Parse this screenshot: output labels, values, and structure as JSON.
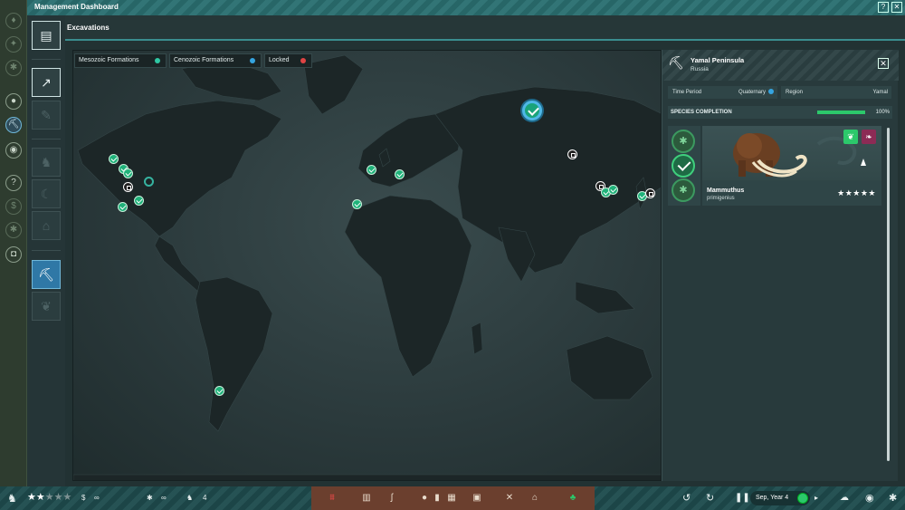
{
  "window": {
    "title": "Management Dashboard",
    "help_label": "?",
    "close_label": "✕"
  },
  "section": {
    "title": "Excavations"
  },
  "legend": [
    {
      "label": "Mesozoic Formations",
      "color": "#2fc7a3"
    },
    {
      "label": "Cenozoic Formations",
      "color": "#35a4e0"
    },
    {
      "label": "Locked",
      "color": "#e04444"
    }
  ],
  "rail_icons": [
    "dino-icon",
    "fossil-icon",
    "gear-icon",
    "egg-icon",
    "excavate-icon",
    "eye-icon",
    "help-icon",
    "coin-icon",
    "settings-icon",
    "camera-icon"
  ],
  "tool_icons": [
    "report-icon",
    "chart-icon",
    "blank-icon",
    "dino-icon",
    "moon-icon",
    "dome-icon",
    "dig-icon",
    "leaf-icon"
  ],
  "panel": {
    "site_name": "Yamal Peninsula",
    "country": "Russia",
    "time_period_label": "Time Period",
    "time_period_value": "Quaternary",
    "region_label": "Region",
    "region_value": "Yamal",
    "completion_label": "SPECIES COMPLETION",
    "completion_pct": "100%",
    "completion_fraction": 1.0,
    "species_genus": "Mammuthus",
    "species_name": "primigenius",
    "rating": "★★★★★",
    "diet_icon": "leaf-icon",
    "type_icon": "feather-icon",
    "stage_icons": [
      "paw-icon",
      "check-icon",
      "paw-icon"
    ]
  },
  "bottom": {
    "rating_on": "★★",
    "rating_off": "★★★",
    "money": "∞",
    "research": "∞",
    "dinos": "4",
    "date": "Sep, Year 4",
    "build_icons": [
      "fence-icon",
      "gate-icon",
      "dino-icon",
      "egg-icon",
      "hatchery-icon",
      "shop-icon",
      "building-icon",
      "tools-icon",
      "shelter-icon",
      "tree-icon"
    ]
  }
}
